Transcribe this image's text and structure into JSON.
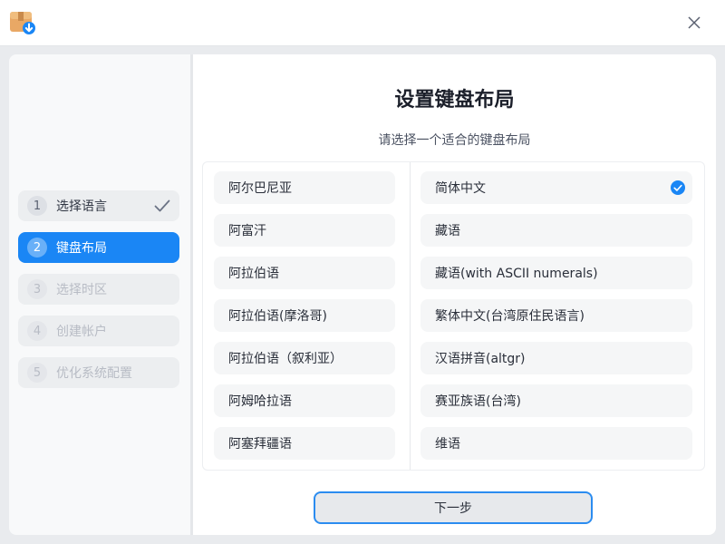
{
  "window": {
    "app_icon": "package-download-icon",
    "close_icon": "close-icon"
  },
  "sidebar": {
    "steps": [
      {
        "number": "1",
        "label": "选择语言",
        "state": "completed"
      },
      {
        "number": "2",
        "label": "键盘布局",
        "state": "active"
      },
      {
        "number": "3",
        "label": "选择时区",
        "state": "disabled"
      },
      {
        "number": "4",
        "label": "创建帐户",
        "state": "disabled"
      },
      {
        "number": "5",
        "label": "优化系统配置",
        "state": "disabled"
      }
    ]
  },
  "main": {
    "title": "设置键盘布局",
    "subtitle": "请选择一个适合的键盘布局",
    "languages": [
      "阿尔巴尼亚",
      "阿富汗",
      "阿拉伯语",
      "阿拉伯语(摩洛哥)",
      "阿拉伯语（叙利亚）",
      "阿姆哈拉语",
      "阿塞拜疆语"
    ],
    "layouts": [
      "简体中文",
      "藏语",
      "藏语(with ASCII numerals)",
      "繁体中文(台湾原住民语言)",
      "汉语拼音(altgr)",
      "赛亚族语(台湾)",
      "维语"
    ],
    "selected_layout": "简体中文",
    "next_button": "下一步"
  },
  "colors": {
    "accent": "#1a86f5",
    "background": "#e9ebee"
  }
}
